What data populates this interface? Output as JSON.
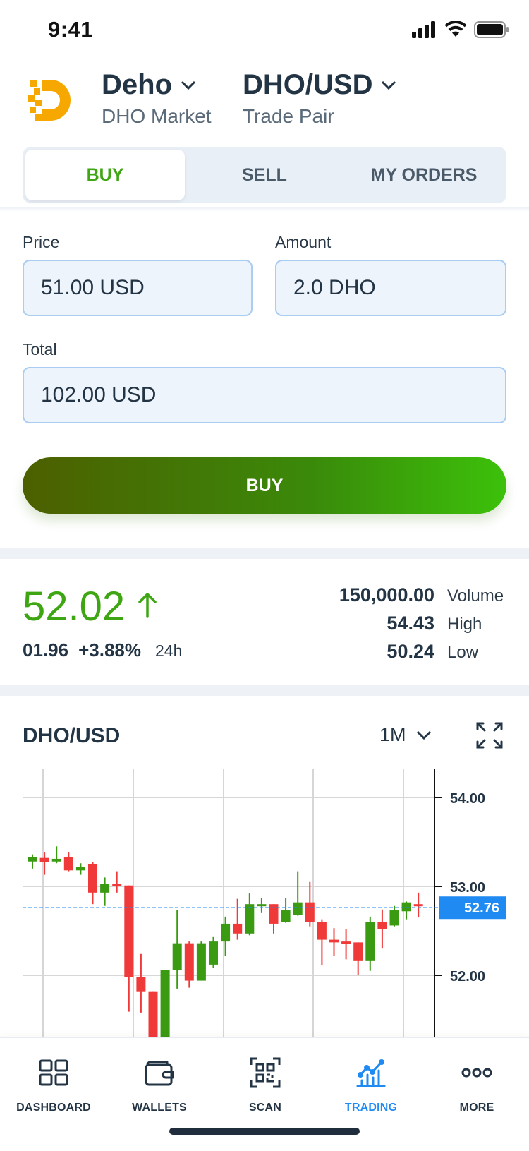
{
  "status_bar": {
    "time": "9:41"
  },
  "header": {
    "market": {
      "title": "Deho",
      "subtitle": "DHO Market"
    },
    "pair": {
      "title": "DHO/USD",
      "subtitle": "Trade Pair"
    }
  },
  "tabs": [
    {
      "label": "BUY",
      "active": true
    },
    {
      "label": "SELL",
      "active": false
    },
    {
      "label": "MY ORDERS",
      "active": false
    }
  ],
  "form": {
    "price_label": "Price",
    "price_value": "51.00 USD",
    "amount_label": "Amount",
    "amount_value": "2.0 DHO",
    "total_label": "Total",
    "total_value": "102.00 USD",
    "submit_label": "BUY"
  },
  "stats": {
    "price": "52.02",
    "change_abs": "01.96",
    "change_pct": "+3.88%",
    "period": "24h",
    "volume_value": "150,000.00",
    "volume_label": "Volume",
    "high_value": "54.43",
    "high_label": "High",
    "low_value": "50.24",
    "low_label": "Low"
  },
  "chart_header": {
    "title": "DHO/USD",
    "interval": "1M"
  },
  "chart_data": {
    "type": "candlestick",
    "y_ticks": [
      54.0,
      53.0,
      52.0
    ],
    "y_tick_labels": [
      "54.00",
      "53.00",
      "52.00"
    ],
    "current_price": 52.76,
    "current_price_label": "52.76",
    "grid": true,
    "colors": {
      "up": "#3a9a12",
      "down": "#f03a3a",
      "current_line": "#1f8bf2",
      "current_tag": "#1f8bf2"
    },
    "candles": [
      {
        "o": 53.28,
        "h": 53.36,
        "l": 53.2,
        "c": 53.33
      },
      {
        "o": 53.32,
        "h": 53.38,
        "l": 53.13,
        "c": 53.27
      },
      {
        "o": 53.28,
        "h": 53.45,
        "l": 53.26,
        "c": 53.31
      },
      {
        "o": 53.33,
        "h": 53.38,
        "l": 53.17,
        "c": 53.18
      },
      {
        "o": 53.18,
        "h": 53.26,
        "l": 53.13,
        "c": 53.22
      },
      {
        "o": 53.25,
        "h": 53.27,
        "l": 52.8,
        "c": 52.93
      },
      {
        "o": 52.93,
        "h": 53.1,
        "l": 52.78,
        "c": 53.03
      },
      {
        "o": 53.03,
        "h": 53.17,
        "l": 52.93,
        "c": 53.01
      },
      {
        "o": 53.01,
        "h": 53.01,
        "l": 51.59,
        "c": 51.98
      },
      {
        "o": 51.98,
        "h": 52.24,
        "l": 51.58,
        "c": 51.82
      },
      {
        "o": 51.82,
        "h": 51.82,
        "l": 50.9,
        "c": 50.95
      },
      {
        "o": 51.04,
        "h": 52.06,
        "l": 50.9,
        "c": 52.06
      },
      {
        "o": 52.06,
        "h": 52.73,
        "l": 51.85,
        "c": 52.36
      },
      {
        "o": 52.36,
        "h": 52.38,
        "l": 51.86,
        "c": 51.94
      },
      {
        "o": 51.94,
        "h": 52.38,
        "l": 51.94,
        "c": 52.36
      },
      {
        "o": 52.12,
        "h": 52.43,
        "l": 52.08,
        "c": 52.38
      },
      {
        "o": 52.38,
        "h": 52.66,
        "l": 52.22,
        "c": 52.58
      },
      {
        "o": 52.58,
        "h": 52.86,
        "l": 52.4,
        "c": 52.47
      },
      {
        "o": 52.47,
        "h": 52.92,
        "l": 52.45,
        "c": 52.8
      },
      {
        "o": 52.8,
        "h": 52.87,
        "l": 52.7,
        "c": 52.8
      },
      {
        "o": 52.8,
        "h": 52.8,
        "l": 52.47,
        "c": 52.58
      },
      {
        "o": 52.6,
        "h": 52.87,
        "l": 52.59,
        "c": 52.73
      },
      {
        "o": 52.68,
        "h": 53.17,
        "l": 52.67,
        "c": 52.82
      },
      {
        "o": 52.82,
        "h": 53.05,
        "l": 52.55,
        "c": 52.6
      },
      {
        "o": 52.6,
        "h": 52.63,
        "l": 52.11,
        "c": 52.4
      },
      {
        "o": 52.4,
        "h": 52.53,
        "l": 52.22,
        "c": 52.37
      },
      {
        "o": 52.38,
        "h": 52.52,
        "l": 52.18,
        "c": 52.35
      },
      {
        "o": 52.37,
        "h": 52.37,
        "l": 52.0,
        "c": 52.16
      },
      {
        "o": 52.16,
        "h": 52.66,
        "l": 52.05,
        "c": 52.6
      },
      {
        "o": 52.6,
        "h": 52.74,
        "l": 52.3,
        "c": 52.52
      },
      {
        "o": 52.56,
        "h": 52.78,
        "l": 52.55,
        "c": 52.73
      },
      {
        "o": 52.72,
        "h": 52.83,
        "l": 52.63,
        "c": 52.82
      },
      {
        "o": 52.8,
        "h": 52.93,
        "l": 52.65,
        "c": 52.78
      }
    ]
  },
  "bottom_nav": [
    {
      "label": "DASHBOARD",
      "icon": "dashboard-icon",
      "active": false
    },
    {
      "label": "WALLETS",
      "icon": "wallet-icon",
      "active": false
    },
    {
      "label": "SCAN",
      "icon": "qr-scan-icon",
      "active": false
    },
    {
      "label": "TRADING",
      "icon": "trading-chart-icon",
      "active": true
    },
    {
      "label": "MORE",
      "icon": "more-dots-icon",
      "active": false
    }
  ]
}
